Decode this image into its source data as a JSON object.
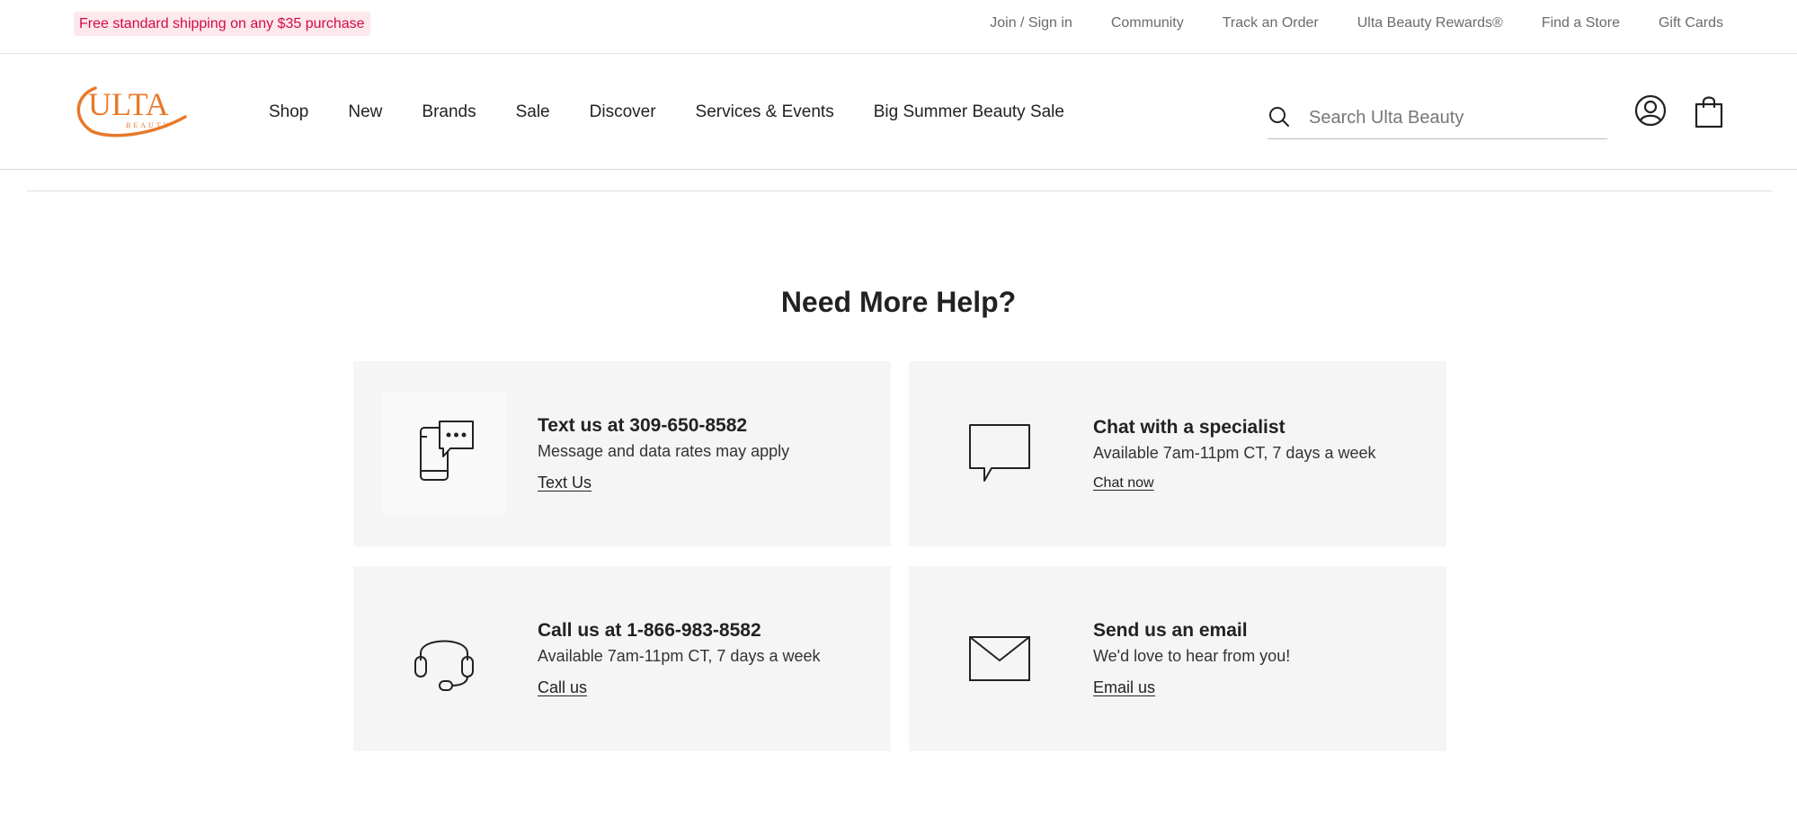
{
  "promo": {
    "text": "Free standard shipping on any $35 purchase"
  },
  "utility_links": [
    "Join / Sign in",
    "Community",
    "Track an Order",
    "Ulta Beauty Rewards®",
    "Find a Store",
    "Gift Cards"
  ],
  "logo": {
    "text": "ULTA",
    "subtext": "BEAUTY",
    "color": "#e8792a"
  },
  "nav": [
    "Shop",
    "New",
    "Brands",
    "Sale",
    "Discover",
    "Services & Events",
    "Big Summer Beauty Sale"
  ],
  "search": {
    "placeholder": "Search Ulta Beauty",
    "value": ""
  },
  "help": {
    "title": "Need More Help?",
    "cards": [
      {
        "icon": "phone-text-icon",
        "title": "Text us at 309-650-8582",
        "subtitle": "Message and data rates may apply",
        "link": "Text Us"
      },
      {
        "icon": "chat-bubble-icon",
        "title": "Chat with a specialist",
        "subtitle": "Available 7am-11pm CT, 7 days a week",
        "link": "Chat now"
      },
      {
        "icon": "headset-icon",
        "title": "Call us at 1-866-983-8582",
        "subtitle": "Available 7am-11pm CT, 7 days a week",
        "link": "Call us"
      },
      {
        "icon": "envelope-icon",
        "title": "Send us an email",
        "subtitle": "We'd love to hear from you!",
        "link": "Email us"
      }
    ]
  },
  "colors": {
    "promo_text": "#d10a4f",
    "promo_bg": "#fde8ec",
    "card_bg": "#f5f5f5",
    "brand_orange": "#e8792a"
  }
}
